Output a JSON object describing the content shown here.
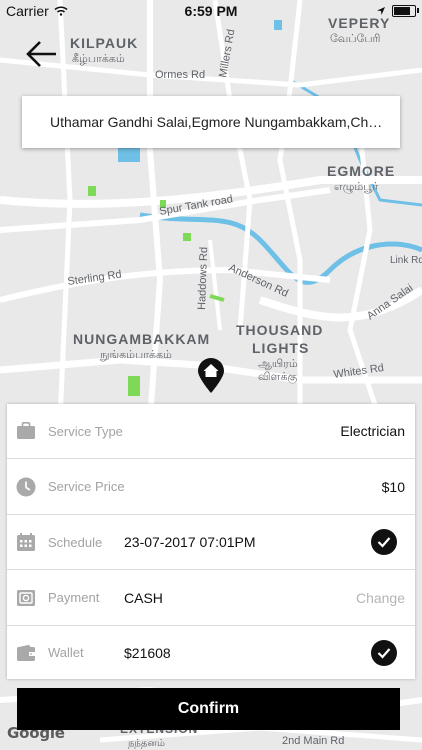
{
  "status_bar": {
    "carrier": "Carrier",
    "time": "6:59 PM"
  },
  "map": {
    "labels": [
      {
        "text": "KILPAUK"
      },
      {
        "text": "கீழ்பாக்கம்"
      },
      {
        "text": "VEPERY"
      },
      {
        "text": "வேப்பேரி"
      },
      {
        "text": "EGMORE"
      },
      {
        "text": "எழும்பூர்"
      },
      {
        "text": "NUNGAMBAKKAM"
      },
      {
        "text": "நுங்கம்பாக்கம்"
      },
      {
        "text": "THOUSAND"
      },
      {
        "text": "LIGHTS"
      },
      {
        "text": "ஆயிரம்"
      },
      {
        "text": "விளக்கு"
      },
      {
        "text": "Ormes Rd"
      },
      {
        "text": "Millers Rd"
      },
      {
        "text": "Spur Tank road"
      },
      {
        "text": "Sterling Rd"
      },
      {
        "text": "Haddows Rd"
      },
      {
        "text": "Anderson Rd"
      },
      {
        "text": "Link Rd"
      },
      {
        "text": "Anna Salai"
      },
      {
        "text": "Whites Rd"
      },
      {
        "text": "2nd Main Rd"
      },
      {
        "text": "EXTENSION"
      },
      {
        "text": "நந்தனம்"
      }
    ],
    "attribution": "Google"
  },
  "address": {
    "text": "Uthamar Gandhi Salai,Egmore Nungambakkam,Chen..."
  },
  "details": {
    "service_type": {
      "label": "Service Type",
      "value": "Electrician",
      "icon": "briefcase-icon"
    },
    "service_price": {
      "label": "Service Price",
      "value": "$10",
      "icon": "clock-icon"
    },
    "schedule": {
      "label": "Schedule",
      "value": "23-07-2017 07:01PM",
      "icon": "calendar-icon"
    },
    "payment": {
      "label": "Payment",
      "value": "CASH",
      "action": "Change",
      "icon": "cash-icon"
    },
    "wallet": {
      "label": "Wallet",
      "value": "$21608",
      "icon": "wallet-icon"
    }
  },
  "confirm_label": "Confirm",
  "colors": {
    "accent": "#000000",
    "map_bg": "#e9e9ea",
    "road": "#ffffff",
    "water": "#6fc0e6",
    "park": "#7ed957"
  }
}
